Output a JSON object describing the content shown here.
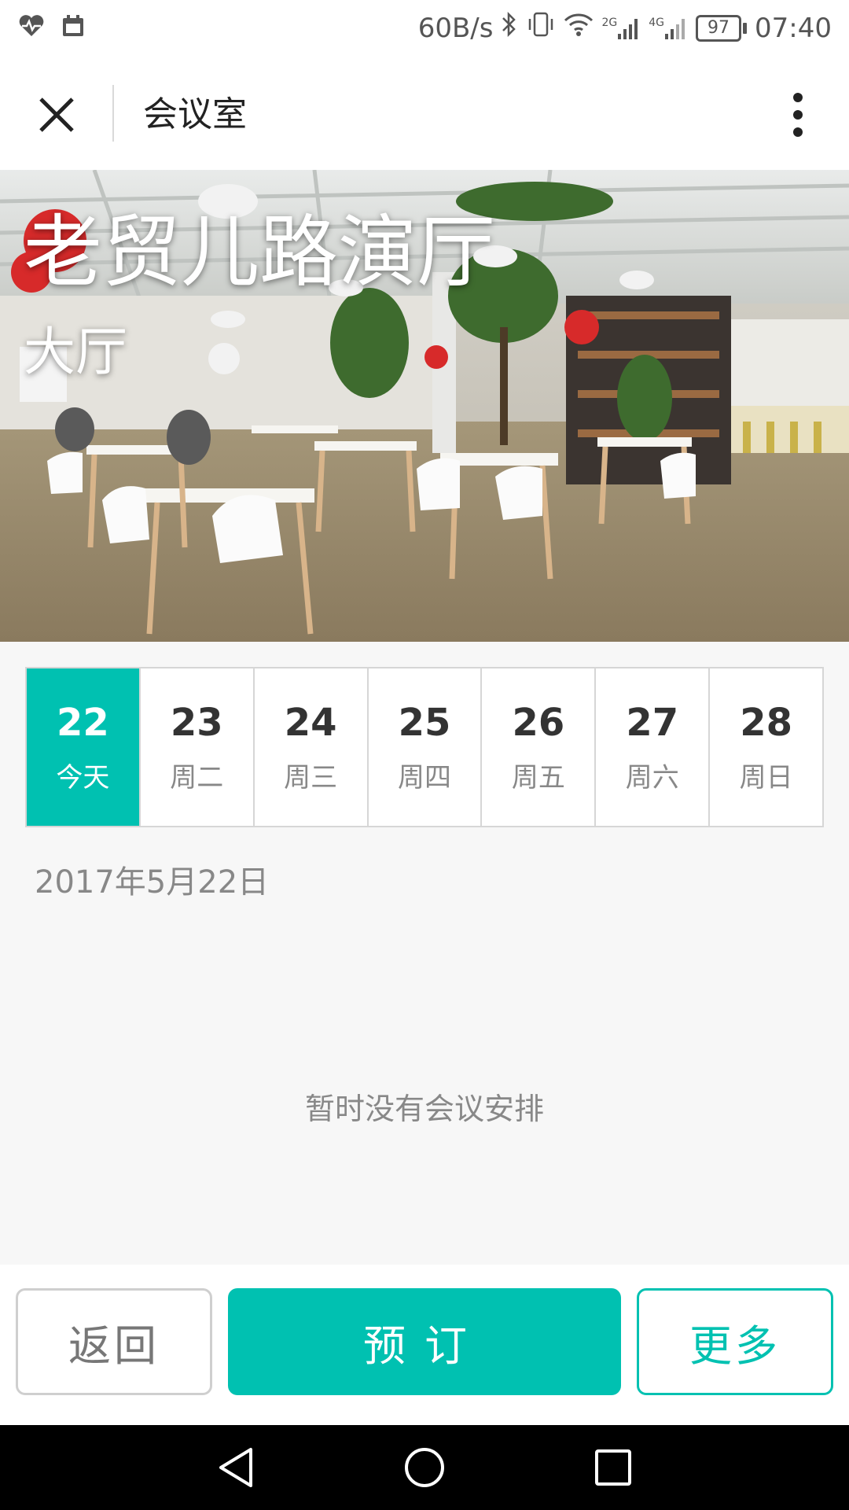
{
  "status_bar": {
    "net_speed": "60B/s",
    "battery": "97",
    "time": "07:40",
    "signal_2g": "2G",
    "signal_4g": "4G"
  },
  "header": {
    "title": "会议室"
  },
  "hero": {
    "title": "老贸儿路演厅",
    "subtitle": "大厅"
  },
  "dates": [
    {
      "day": "22",
      "label": "今天"
    },
    {
      "day": "23",
      "label": "周二"
    },
    {
      "day": "24",
      "label": "周三"
    },
    {
      "day": "25",
      "label": "周四"
    },
    {
      "day": "26",
      "label": "周五"
    },
    {
      "day": "27",
      "label": "周六"
    },
    {
      "day": "28",
      "label": "周日"
    }
  ],
  "selected_date": "2017年5月22日",
  "empty_message": "暂时没有会议安排",
  "actions": {
    "back": "返回",
    "book": "预订",
    "more": "更多"
  },
  "colors": {
    "accent": "#00c1b1"
  }
}
